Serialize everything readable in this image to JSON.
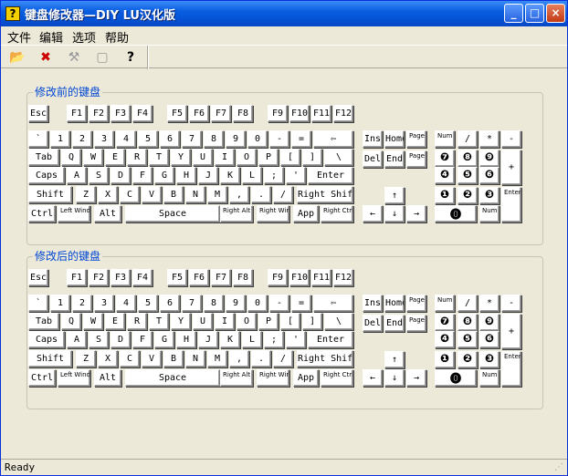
{
  "window": {
    "title": "键盘修改器—DIY  LU汉化版",
    "icon": "?",
    "buttons": {
      "minimize": "_",
      "maximize": "□",
      "close": "×"
    }
  },
  "menu": [
    "文件",
    "编辑",
    "选项",
    "帮助"
  ],
  "toolbar": {
    "icons": [
      "open-icon",
      "delete-icon",
      "tools-icon",
      "preview-icon",
      "help-icon"
    ],
    "glyphs": [
      "📂",
      "✖",
      "⚒",
      "▢",
      "?"
    ]
  },
  "groups": {
    "before": "修改前的键盘",
    "after": "修改后的键盘"
  },
  "keyboard": {
    "fn_row": [
      "Esc",
      "F1",
      "F2",
      "F3",
      "F4",
      "F5",
      "F6",
      "F7",
      "F8",
      "F9",
      "F10",
      "F11",
      "F12"
    ],
    "num_row": [
      "`",
      "1",
      "2",
      "3",
      "4",
      "5",
      "6",
      "7",
      "8",
      "9",
      "0",
      "-",
      "=",
      "⇦"
    ],
    "tab_row": [
      "Tab",
      "Q",
      "W",
      "E",
      "R",
      "T",
      "Y",
      "U",
      "I",
      "O",
      "P",
      "[",
      "]",
      "\\"
    ],
    "caps_row": [
      "Caps",
      "A",
      "S",
      "D",
      "F",
      "G",
      "H",
      "J",
      "K",
      "L",
      ";",
      "'",
      "Enter"
    ],
    "shift_row": [
      "Shift",
      "Z",
      "X",
      "C",
      "V",
      "B",
      "N",
      "M",
      ",",
      ".",
      "/",
      "Right Shift"
    ],
    "ctrl_row": [
      "Ctrl",
      "Left Windows",
      "Alt",
      "Space",
      "Right Alt",
      "Right Windows",
      "App",
      "Right Ctrl"
    ],
    "nav": [
      "Ins",
      "Home",
      "Page Up",
      "Del",
      "End",
      "Page Down"
    ],
    "arrows": [
      "↑",
      "←",
      "↓",
      "→"
    ],
    "numpad": {
      "row1": [
        "Num Lock",
        "/",
        "*",
        "-"
      ],
      "row2": [
        "❼",
        "❽",
        "❾"
      ],
      "row3": [
        "❹",
        "❺",
        "❻"
      ],
      "plus": "+",
      "row4": [
        "❶",
        "❷",
        "❸"
      ],
      "enter": "Enter",
      "zero": "⓿",
      "del": "Num Del"
    }
  },
  "status": "Ready"
}
